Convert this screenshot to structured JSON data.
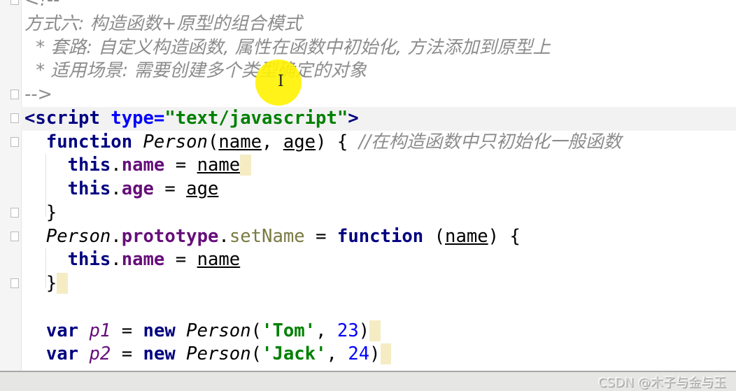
{
  "editor": {
    "lines": [
      [
        {
          "t": "<!--",
          "c": "comment"
        }
      ],
      [
        {
          "t": "方式六: 构造函数+原型的组合模式",
          "c": "comment"
        }
      ],
      [
        {
          "t": "  * 套路: 自定义构造函数, 属性在函数中初始化, 方法添加到原型上",
          "c": "comment"
        }
      ],
      [
        {
          "t": "  * 适用场景: 需要创建多个类型确定的对象",
          "c": "comment"
        }
      ],
      [
        {
          "t": "-->",
          "c": "comment"
        }
      ],
      [
        {
          "t": "<script ",
          "c": "tag"
        },
        {
          "t": "type=",
          "c": "attr"
        },
        {
          "t": "\"text/javascript\"",
          "c": "str"
        },
        {
          "t": ">",
          "c": "tag"
        }
      ],
      [
        {
          "t": "  ",
          "c": "plain"
        },
        {
          "t": "function ",
          "c": "kw"
        },
        {
          "t": "Person",
          "c": "fn"
        },
        {
          "t": "(",
          "c": "plain"
        },
        {
          "t": "name",
          "c": "param"
        },
        {
          "t": ", ",
          "c": "plain"
        },
        {
          "t": "age",
          "c": "param"
        },
        {
          "t": ") { ",
          "c": "plain"
        },
        {
          "t": "//在构造函数中只初始化一般函数",
          "c": "comment"
        }
      ],
      [
        {
          "t": "    ",
          "c": "plain"
        },
        {
          "t": "this",
          "c": "kw"
        },
        {
          "t": ".",
          "c": "plain"
        },
        {
          "t": "name",
          "c": "prop"
        },
        {
          "t": " = ",
          "c": "plain"
        },
        {
          "t": "name",
          "c": "param"
        },
        {
          "t": " ",
          "c": "hl"
        }
      ],
      [
        {
          "t": "    ",
          "c": "plain"
        },
        {
          "t": "this",
          "c": "kw"
        },
        {
          "t": ".",
          "c": "plain"
        },
        {
          "t": "age",
          "c": "prop"
        },
        {
          "t": " = ",
          "c": "plain"
        },
        {
          "t": "age",
          "c": "param"
        }
      ],
      [
        {
          "t": "  }",
          "c": "plain"
        }
      ],
      [
        {
          "t": "  ",
          "c": "plain"
        },
        {
          "t": "Person",
          "c": "fn"
        },
        {
          "t": ".",
          "c": "plain"
        },
        {
          "t": "prototype",
          "c": "prop"
        },
        {
          "t": ".",
          "c": "plain"
        },
        {
          "t": "setName",
          "c": "method"
        },
        {
          "t": " = ",
          "c": "plain"
        },
        {
          "t": "function ",
          "c": "kw"
        },
        {
          "t": "(",
          "c": "plain"
        },
        {
          "t": "name",
          "c": "param"
        },
        {
          "t": ") {",
          "c": "plain"
        }
      ],
      [
        {
          "t": "    ",
          "c": "plain"
        },
        {
          "t": "this",
          "c": "kw"
        },
        {
          "t": ".",
          "c": "plain"
        },
        {
          "t": "name",
          "c": "prop"
        },
        {
          "t": " = ",
          "c": "plain"
        },
        {
          "t": "name",
          "c": "param"
        }
      ],
      [
        {
          "t": "  }",
          "c": "plain"
        },
        {
          "t": " ",
          "c": "hl"
        }
      ],
      [],
      [
        {
          "t": "  ",
          "c": "plain"
        },
        {
          "t": "var ",
          "c": "kw"
        },
        {
          "t": "p1",
          "c": "var"
        },
        {
          "t": " = ",
          "c": "plain"
        },
        {
          "t": "new ",
          "c": "kw"
        },
        {
          "t": "Person",
          "c": "fn"
        },
        {
          "t": "(",
          "c": "plain"
        },
        {
          "t": "'Tom'",
          "c": "str"
        },
        {
          "t": ", ",
          "c": "plain"
        },
        {
          "t": "23",
          "c": "num"
        },
        {
          "t": ")",
          "c": "plain"
        },
        {
          "t": " ",
          "c": "hl"
        }
      ],
      [
        {
          "t": "  ",
          "c": "plain"
        },
        {
          "t": "var ",
          "c": "kw"
        },
        {
          "t": "p2",
          "c": "var"
        },
        {
          "t": " = ",
          "c": "plain"
        },
        {
          "t": "new ",
          "c": "kw"
        },
        {
          "t": "Person",
          "c": "fn"
        },
        {
          "t": "(",
          "c": "plain"
        },
        {
          "t": "'Jack'",
          "c": "str"
        },
        {
          "t": ", ",
          "c": "plain"
        },
        {
          "t": "24",
          "c": "num"
        },
        {
          "t": ")",
          "c": "plain"
        },
        {
          "t": " ",
          "c": "hl"
        }
      ]
    ]
  },
  "colors": {
    "cursor_highlight": "#fff200",
    "keyword": "#000080",
    "string": "#008000",
    "property": "#660e7a",
    "comment": "#8c8c8c"
  },
  "watermark": "CSDN @木子与金与玉"
}
